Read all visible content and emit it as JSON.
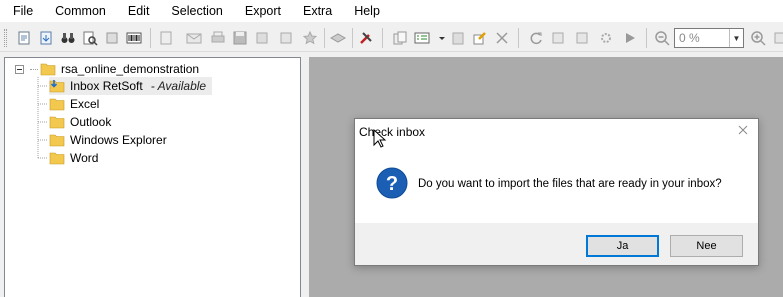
{
  "menu": [
    "File",
    "Common",
    "Edit",
    "Selection",
    "Export",
    "Extra",
    "Help"
  ],
  "toolbar": {
    "zoom_value": "0 %",
    "icons": [
      "open-icon",
      "import-icon",
      "binoculars-icon",
      "find-document-icon",
      "scan-icon",
      "barcode-icon",
      "export-icon",
      "email-icon",
      "print-icon",
      "save-icon",
      "stamp-icon",
      "note-icon",
      "star-icon",
      "layers-icon",
      "tools-icon",
      "copy-to-icon",
      "checklist-icon",
      "duplicate-icon",
      "edit-icon",
      "scissors-icon",
      "refresh-icon",
      "page-copy-icon",
      "page-paste-icon",
      "settings-icon",
      "play-icon",
      "zoom-out-icon",
      "zoom-in-icon"
    ]
  },
  "tree": {
    "root": "rsa_online_demonstration",
    "children": [
      {
        "label": "Inbox RetSoft",
        "status": "- Available"
      },
      {
        "label": "Excel",
        "status": ""
      },
      {
        "label": "Outlook",
        "status": ""
      },
      {
        "label": "Windows Explorer",
        "status": ""
      },
      {
        "label": "Word",
        "status": ""
      }
    ]
  },
  "dialog": {
    "title": "Check inbox",
    "message": "Do you want to import the files that are ready in your inbox?",
    "yes_label": "Ja",
    "no_label": "Nee"
  },
  "colors": {
    "accent": "#0078d7",
    "folder": "#f3c84f",
    "question_icon": "#1a5fb4",
    "workspace_bg": "#ababab"
  }
}
